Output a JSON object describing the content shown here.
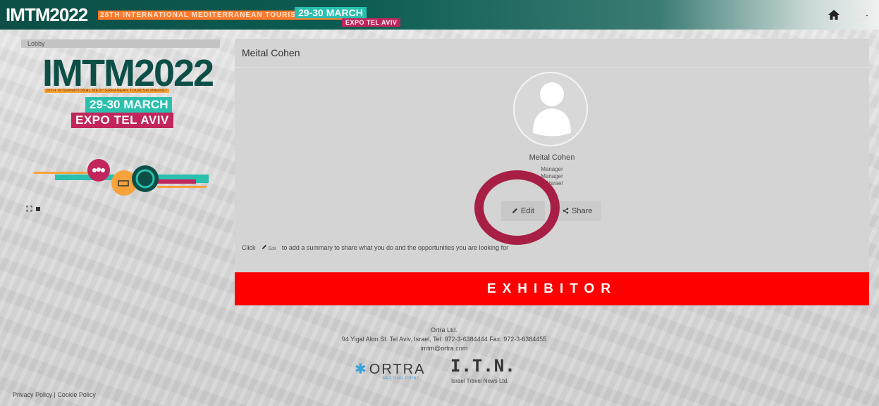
{
  "header": {
    "logo_text": "IMTM2022",
    "tagline": "28TH INTERNATIONAL MEDITERRANEAN TOURISM MARKET",
    "date": "29-30 MARCH",
    "venue": "EXPO TEL AVIV",
    "icons": [
      "home-icon",
      "user-icon"
    ]
  },
  "sidebar": {
    "breadcrumb": "Lobby",
    "logo": {
      "text": "IMTM2022",
      "tagline": "28TH INTERNATIONAL MEDITERRANEAN TOURISM MARKET",
      "date": "29-30 MARCH",
      "venue": "EXPO TEL AVIV"
    }
  },
  "profile": {
    "panel_title": "Meital Cohen",
    "name": "Meital Cohen",
    "job_title": "Manager",
    "organization": "Manager",
    "country": "Israel",
    "edit_label": "Edit",
    "share_label": "Share",
    "summary": {
      "prefix": "Click",
      "inline_edit": "Edit",
      "suffix": "to add a summary to share what you do and the opportunities you are looking for"
    },
    "badge": "EXHIBITOR"
  },
  "footer": {
    "company": "Ortra Ltd.",
    "address": "94 Yigal Alon St. Tel Aviv, Israel, Tel: 972-3-6384444 Fax: 972-3-6384455",
    "email": "imtm@ortra.com",
    "partner1": "ORTRA",
    "partner1_sub": "MEETING POINT",
    "partner2": "I.T.N.",
    "partner2_sub": "Israel Travel News Ltd.",
    "policy": "Privacy Policy | Cookie Policy"
  },
  "colors": {
    "brand_dark": "#0d4f47",
    "teal": "#2bbfae",
    "magenta": "#c2255c",
    "exhibitor_red": "#ff0000",
    "highlight_ring": "#a81f46"
  }
}
